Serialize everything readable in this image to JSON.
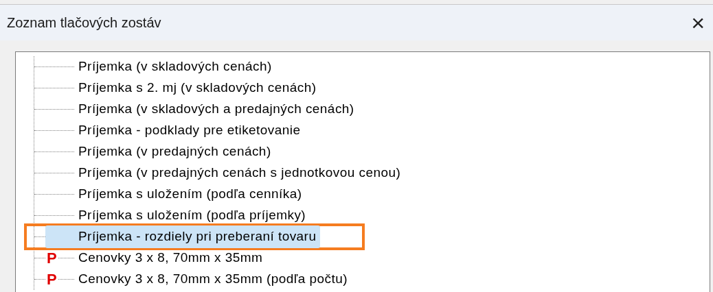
{
  "window": {
    "title": "Zoznam tlačových zostáv",
    "close": "×"
  },
  "tree": {
    "items": [
      {
        "kind": "report",
        "label": "Príjemka  (v skladových cenách)",
        "selected": false
      },
      {
        "kind": "report",
        "label": "Príjemka s 2. mj  (v skladových cenách)",
        "selected": false
      },
      {
        "kind": "report",
        "label": "Príjemka  (v skladových a predajných cenách)",
        "selected": false
      },
      {
        "kind": "report",
        "label": "Príjemka - podklady pre etiketovanie",
        "selected": false
      },
      {
        "kind": "report",
        "label": "Príjemka  (v predajných cenách)",
        "selected": false
      },
      {
        "kind": "report",
        "label": "Príjemka  (v predajných cenách s jednotkovou cenou)",
        "selected": false
      },
      {
        "kind": "report",
        "label": "Príjemka s uložením (podľa cenníka)",
        "selected": false
      },
      {
        "kind": "report",
        "label": "Príjemka s uložením (podľa príjemky)",
        "selected": false
      },
      {
        "kind": "report",
        "label": "Príjemka - rozdiely pri preberaní tovaru",
        "selected": true
      },
      {
        "kind": "print",
        "icon": "P",
        "label": "Cenovky 3 x 8, 70mm x 35mm",
        "selected": false
      },
      {
        "kind": "print",
        "icon": "P",
        "label": "Cenovky 3 x 8, 70mm x 35mm (podľa počtu)",
        "selected": false
      }
    ]
  }
}
